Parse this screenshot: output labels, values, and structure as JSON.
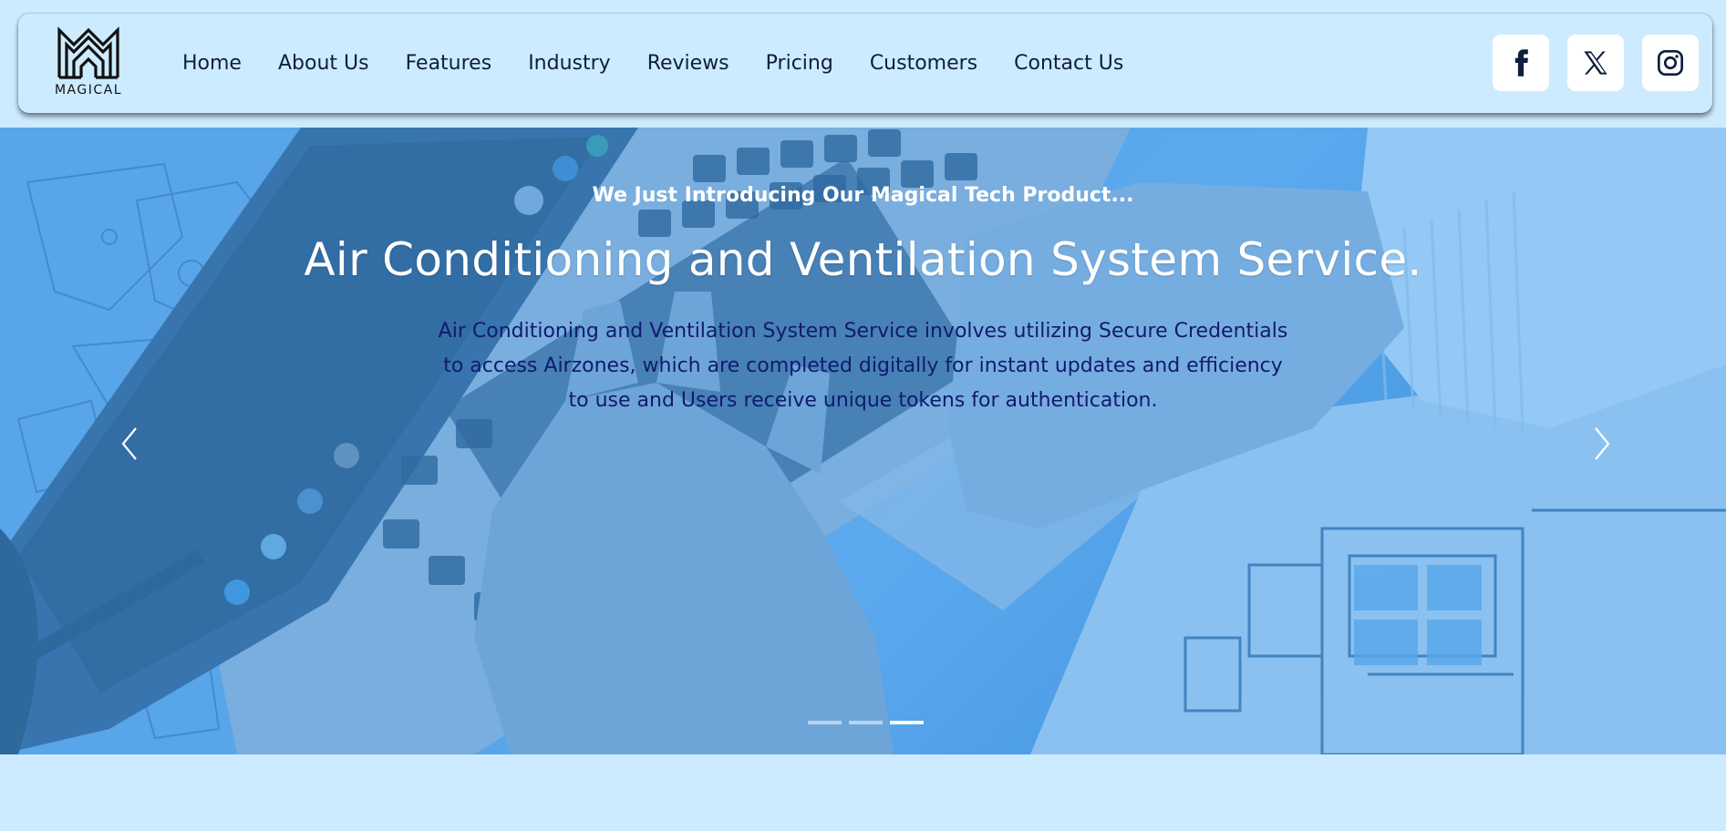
{
  "brand": {
    "name": "MAGICAL"
  },
  "nav": {
    "items": [
      {
        "label": "Home"
      },
      {
        "label": "About Us"
      },
      {
        "label": "Features"
      },
      {
        "label": "Industry"
      },
      {
        "label": "Reviews"
      },
      {
        "label": "Pricing"
      },
      {
        "label": "Customers"
      },
      {
        "label": "Contact Us"
      }
    ]
  },
  "socials": [
    {
      "icon": "facebook-icon"
    },
    {
      "icon": "x-twitter-icon"
    },
    {
      "icon": "instagram-icon"
    }
  ],
  "hero": {
    "eyebrow": "We Just Introducing Our Magical Tech Product...",
    "title": "Air Conditioning and Ventilation System Service.",
    "description": "Air Conditioning and Ventilation System Service involves utilizing Secure Credentials to access Airzones, which are completed digitally for instant updates and efficiency to use and Users receive unique tokens for authentication.",
    "slide_count": 3,
    "active_slide": 3
  },
  "colors": {
    "page_background": "#cdebff",
    "nav_text": "#0e1e3d",
    "hero_description": "#121a6e",
    "social_button_bg": "#ffffff"
  }
}
